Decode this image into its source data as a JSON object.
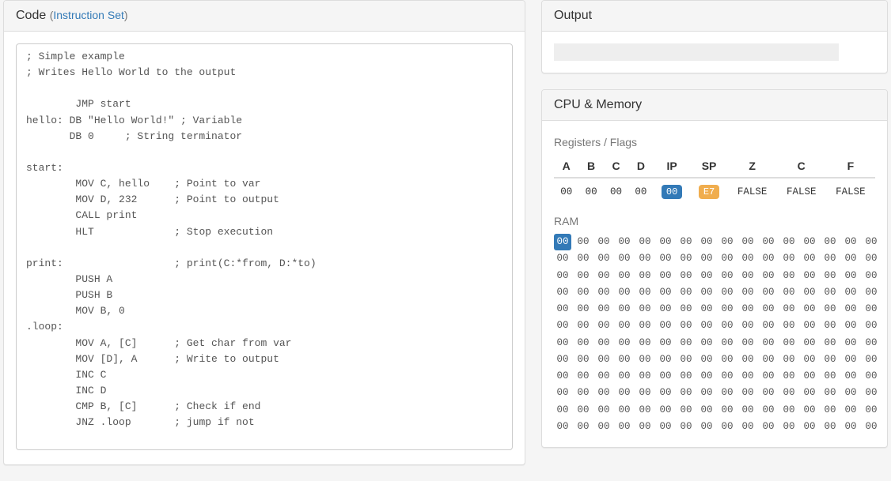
{
  "code_panel": {
    "title": "Code",
    "link_label": "Instruction Set",
    "source": "; Simple example\n; Writes Hello World to the output\n\n        JMP start\nhello: DB \"Hello World!\" ; Variable\n       DB 0     ; String terminator\n\nstart:\n        MOV C, hello    ; Point to var\n        MOV D, 232      ; Point to output\n        CALL print\n        HLT             ; Stop execution\n\nprint:                  ; print(C:*from, D:*to)\n        PUSH A\n        PUSH B\n        MOV B, 0\n.loop:\n        MOV A, [C]      ; Get char from var\n        MOV [D], A      ; Write to output\n        INC C\n        INC D\n        CMP B, [C]      ; Check if end\n        JNZ .loop       ; jump if not"
  },
  "output_panel": {
    "title": "Output",
    "cells": 24
  },
  "cpu_panel": {
    "title": "CPU & Memory",
    "registers_label": "Registers / Flags",
    "registers": {
      "headers": [
        "A",
        "B",
        "C",
        "D",
        "IP",
        "SP",
        "Z",
        "C",
        "F"
      ],
      "values": [
        "00",
        "00",
        "00",
        "00",
        "00",
        "E7",
        "FALSE",
        "FALSE",
        "FALSE"
      ],
      "ip_index": 4,
      "sp_index": 5
    },
    "ram_label": "RAM",
    "ram": {
      "cols": 16,
      "rows": 12,
      "value": "00",
      "highlight_index": 0
    }
  }
}
